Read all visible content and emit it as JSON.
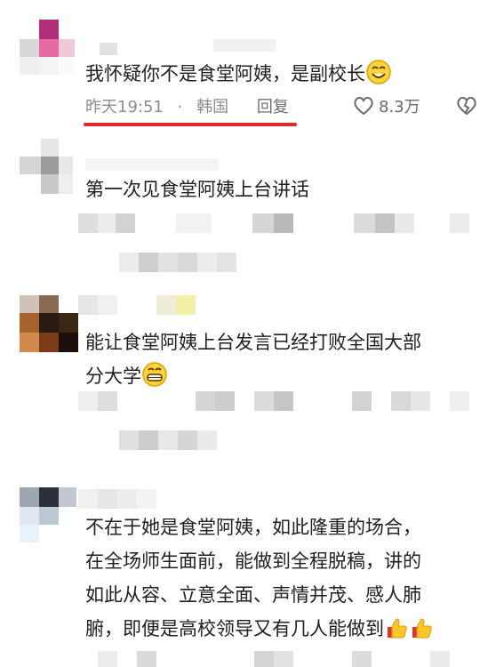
{
  "comments": [
    {
      "text": "我怀疑你不是食堂阿姨，是副校长",
      "emoji": "smile-emoji",
      "time": "昨天19:51",
      "separator": "·",
      "location": "韩国",
      "reply": "回复",
      "likes": "8.3万"
    },
    {
      "text": "第一次见食堂阿姨上台讲话"
    },
    {
      "line1": "能让食堂阿姨上台发言已经打败全国大部",
      "line2": "分大学",
      "emoji": "grin-emoji"
    },
    {
      "line1": "不在于她是食堂阿姨，如此隆重的场合，",
      "line2": "在全场师生面前，能做到全程脱稿，讲的",
      "line3": "如此从容、立意全面、声情并茂、感人肺",
      "line4": "腑，即便是高校领导又有几人能做到",
      "emoji": "thumbs-up-emoji"
    }
  ],
  "colors": {
    "underline": "#e0262f",
    "meta_gray": "#8c8c8c",
    "text": "#202020"
  }
}
